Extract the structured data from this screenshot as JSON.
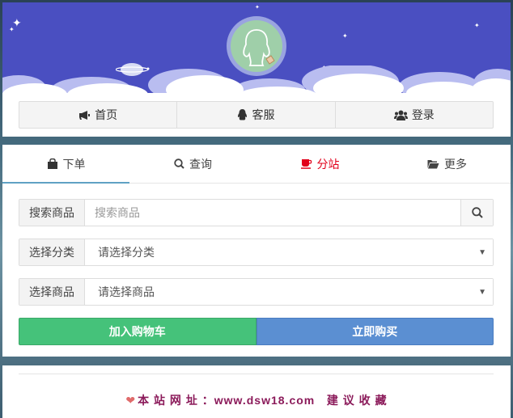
{
  "nav": {
    "home": "首页",
    "service": "客服",
    "login": "登录"
  },
  "tabs": {
    "order": "下单",
    "query": "查询",
    "substation": "分站",
    "more": "更多"
  },
  "form": {
    "search_label": "搜索商品",
    "search_placeholder": "搜索商品",
    "category_label": "选择分类",
    "category_value": "请选择分类",
    "product_label": "选择商品",
    "product_value": "请选择商品"
  },
  "actions": {
    "add_cart": "加入购物车",
    "buy_now": "立即购买"
  },
  "footer": {
    "text": "本 站 网 址 ：www.dsw18.com   建 议 收 藏"
  },
  "colors": {
    "banner": "#4a4fc1",
    "cart_button": "#45c27a",
    "buy_button": "#5b8fd2",
    "active_tab_accent": "#5fa1c4",
    "substation_tab": "#e2001a",
    "footer_text": "#8b1a5a"
  },
  "icons": {
    "home": "bullhorn-icon",
    "service": "qq-penguin-icon",
    "login": "users-icon",
    "order": "shopping-bag-icon",
    "query": "search-icon",
    "substation": "coffee-cup-icon",
    "more": "folder-open-icon",
    "search_button": "search-icon",
    "footer": "heart-icon"
  }
}
